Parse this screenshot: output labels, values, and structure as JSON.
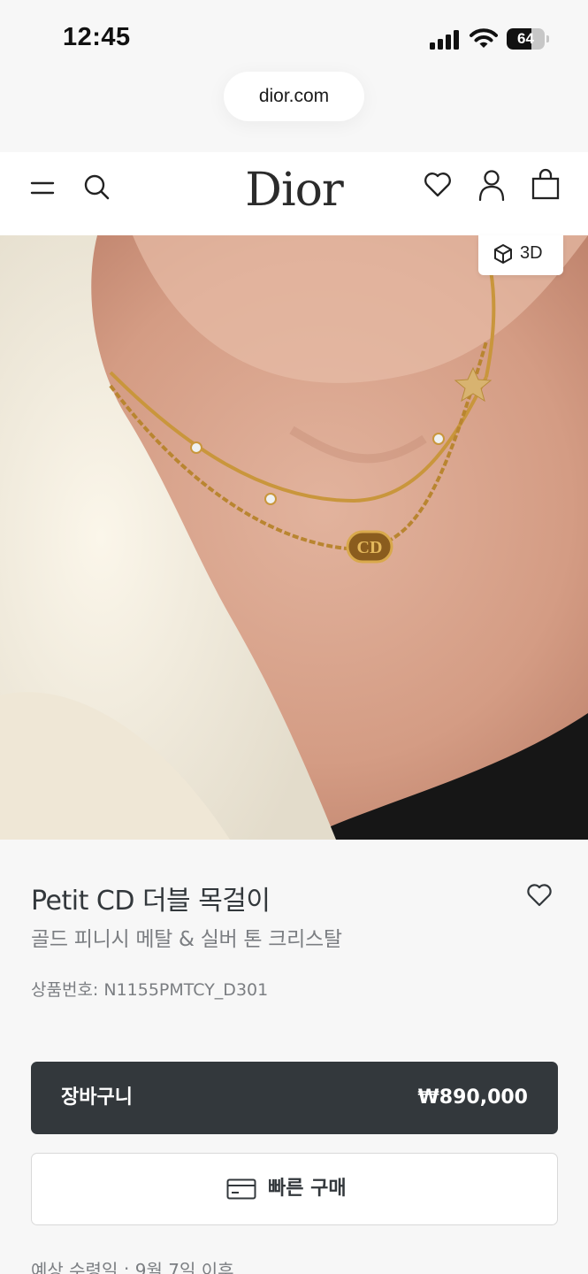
{
  "status_bar": {
    "time": "12:45",
    "battery_level": "64",
    "battery_fraction": 0.64,
    "icons": [
      "cellular-signal-icon",
      "wifi-icon",
      "battery-icon"
    ]
  },
  "browser": {
    "url": "dior.com"
  },
  "header": {
    "logo": "Dior",
    "icons": [
      "menu-icon",
      "search-icon",
      "heart-icon",
      "account-icon",
      "shopping-bag-icon"
    ]
  },
  "gallery": {
    "view_3d_label": "3D",
    "icon": "cube-icon",
    "carousel_progress": 0.75
  },
  "product": {
    "title": "Petit CD 더블 목걸이",
    "subtitle": "골드 피니시 메탈 & 실버 톤 크리스탈",
    "sku": "상품번호: N1155PMTCY_D301",
    "wishlist_icon": "heart-icon"
  },
  "actions": {
    "cart_label": "장바구니",
    "price": "₩890,000",
    "quick_buy_label": "빠른 구매",
    "quick_buy_icon": "credit-card-icon"
  },
  "delivery": {
    "text": "예상 수령일 : 9월 7일 이후"
  },
  "colors": {
    "primary_dark": "#33383c",
    "page_background": "#f7f7f7",
    "secondary_text": "#7b7e82"
  }
}
